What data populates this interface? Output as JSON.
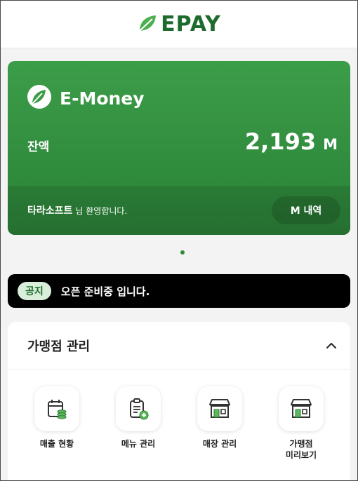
{
  "header": {
    "logo_text": "EPAY",
    "logo_icon": "leaf-icon",
    "brand_color": "#1e6b2e"
  },
  "card": {
    "title": "E-Money",
    "balance_label": "잔액",
    "balance_value": "2,193",
    "balance_unit": "M",
    "welcome_name": "타라소프트",
    "welcome_message": "님 환영합니다.",
    "history_button": "M 내역",
    "accent": "#3c9d49"
  },
  "pagination": {
    "active_index": 0,
    "total": 1
  },
  "notice": {
    "badge": "공지",
    "text": "오픈 준비중 입니다."
  },
  "store_panel": {
    "title": "가맹점 관리",
    "expanded": true,
    "items": [
      {
        "label": "매출 현황",
        "icon": "sales-calendar-icon"
      },
      {
        "label": "메뉴 관리",
        "icon": "menu-clipboard-icon"
      },
      {
        "label": "매장 관리",
        "icon": "store-icon"
      },
      {
        "label": "가맹점\n미리보기",
        "icon": "store-preview-icon"
      }
    ]
  }
}
